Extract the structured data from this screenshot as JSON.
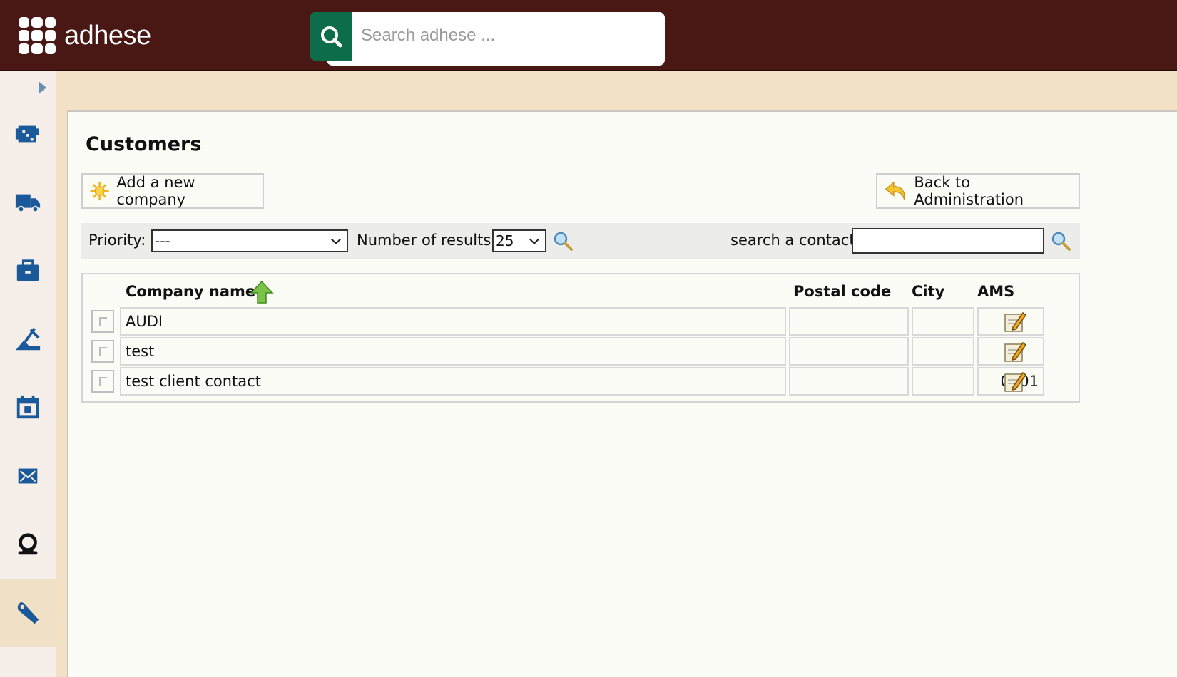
{
  "app": {
    "logo_text": "adhese"
  },
  "search": {
    "placeholder": "Search adhese ..."
  },
  "sidebar": {
    "items": [
      {
        "name": "inventory-icon"
      },
      {
        "name": "delivery-truck-icon"
      },
      {
        "name": "briefcase-icon"
      },
      {
        "name": "tools-icon"
      },
      {
        "name": "calendar-icon"
      },
      {
        "name": "mail-icon"
      },
      {
        "name": "support-icon"
      },
      {
        "name": "wrench-icon",
        "active": true
      }
    ]
  },
  "page": {
    "title": "Customers",
    "add_company_label": "Add a new company",
    "back_label": "Back to Administration"
  },
  "filters": {
    "priority_label": "Priority:",
    "priority_value": "---",
    "results_label": "Number of results",
    "results_value": "25",
    "search_contact_label": "search a contact",
    "search_contact_value": ""
  },
  "table": {
    "headers": {
      "company": "Company name",
      "postal": "Postal code",
      "city": "City",
      "ams": "AMS"
    },
    "rows": [
      {
        "company": "AUDI",
        "postal": "",
        "city": "",
        "ams": ""
      },
      {
        "company": "test",
        "postal": "",
        "city": "",
        "ams": ""
      },
      {
        "company": "test client contact",
        "postal": "",
        "city": "",
        "ams": "0101"
      }
    ]
  },
  "colors": {
    "topbar": "#4a1814",
    "search_button": "#0d6c4a",
    "sidebar_icon": "#1a5a9a",
    "background": "#f2e1c4"
  }
}
